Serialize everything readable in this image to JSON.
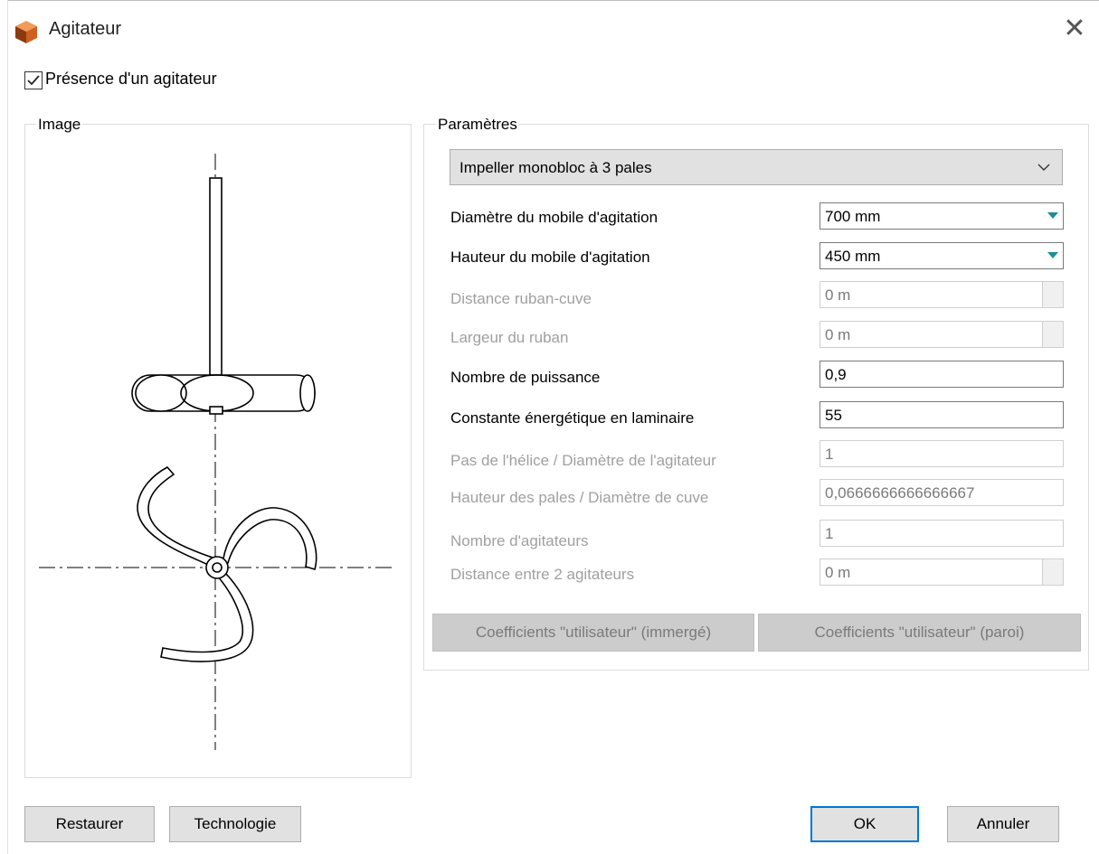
{
  "window": {
    "title": "Agitateur",
    "close_glyph": "✕"
  },
  "presence": {
    "label": "Présence d'un agitateur",
    "checked": true
  },
  "image_group": {
    "legend": "Image"
  },
  "params_group": {
    "legend": "Paramètres",
    "mobile_type": "Impeller monobloc à 3 pales",
    "rows": [
      {
        "label": "Diamètre du mobile d'agitation",
        "value": "700 mm",
        "enabled": true,
        "control": "dropdown"
      },
      {
        "label": "Hauteur du mobile d'agitation",
        "value": "450 mm",
        "enabled": true,
        "control": "dropdown"
      },
      {
        "label": "Distance ruban-cuve",
        "value": "0 m",
        "enabled": false,
        "control": "unit"
      },
      {
        "label": "Largeur du ruban",
        "value": "0 m",
        "enabled": false,
        "control": "unit"
      },
      {
        "label": "Nombre de puissance",
        "value": "0,9",
        "enabled": true,
        "control": "text"
      },
      {
        "label": "Constante énergétique en laminaire",
        "value": "55",
        "enabled": true,
        "control": "text"
      },
      {
        "label": "Pas de l'hélice / Diamètre de l'agitateur",
        "value": "1",
        "enabled": false,
        "control": "text"
      },
      {
        "label": "Hauteur des pales / Diamètre de cuve",
        "value": "0,0666666666666667",
        "enabled": false,
        "control": "text"
      },
      {
        "label": "Nombre d'agitateurs",
        "value": "1",
        "enabled": false,
        "control": "text"
      },
      {
        "label": "Distance entre 2 agitateurs",
        "value": "0 m",
        "enabled": false,
        "control": "unit"
      }
    ],
    "btn_immerge": "Coefficients \"utilisateur\" (immergé)",
    "btn_paroi": "Coefficients \"utilisateur\" (paroi)"
  },
  "footer": {
    "restore": "Restaurer",
    "technology": "Technologie",
    "ok": "OK",
    "cancel": "Annuler"
  },
  "colors": {
    "accent": "#0078d7",
    "dropdown_arrow": "#1a8f96",
    "disabled_text": "#a0a0a0",
    "icon_orange": "#e0702a"
  }
}
